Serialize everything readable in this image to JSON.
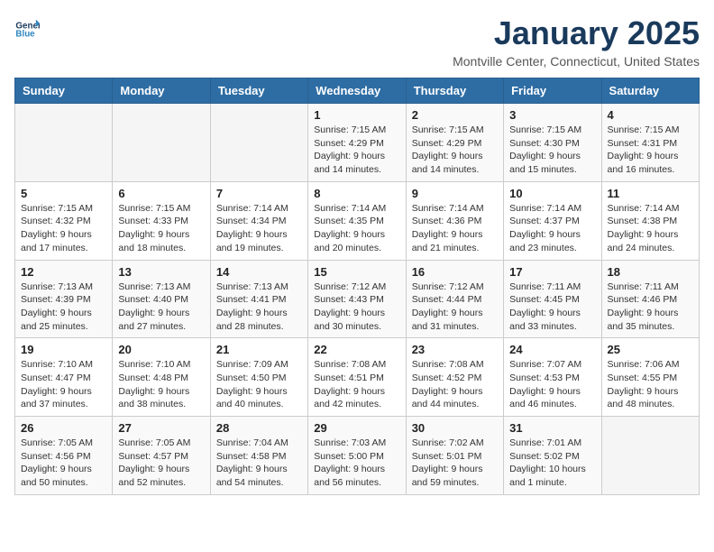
{
  "header": {
    "logo_line1": "General",
    "logo_line2": "Blue",
    "month": "January 2025",
    "location": "Montville Center, Connecticut, United States"
  },
  "days_of_week": [
    "Sunday",
    "Monday",
    "Tuesday",
    "Wednesday",
    "Thursday",
    "Friday",
    "Saturday"
  ],
  "weeks": [
    [
      {
        "day": "",
        "info": ""
      },
      {
        "day": "",
        "info": ""
      },
      {
        "day": "",
        "info": ""
      },
      {
        "day": "1",
        "info": "Sunrise: 7:15 AM\nSunset: 4:29 PM\nDaylight: 9 hours\nand 14 minutes."
      },
      {
        "day": "2",
        "info": "Sunrise: 7:15 AM\nSunset: 4:29 PM\nDaylight: 9 hours\nand 14 minutes."
      },
      {
        "day": "3",
        "info": "Sunrise: 7:15 AM\nSunset: 4:30 PM\nDaylight: 9 hours\nand 15 minutes."
      },
      {
        "day": "4",
        "info": "Sunrise: 7:15 AM\nSunset: 4:31 PM\nDaylight: 9 hours\nand 16 minutes."
      }
    ],
    [
      {
        "day": "5",
        "info": "Sunrise: 7:15 AM\nSunset: 4:32 PM\nDaylight: 9 hours\nand 17 minutes."
      },
      {
        "day": "6",
        "info": "Sunrise: 7:15 AM\nSunset: 4:33 PM\nDaylight: 9 hours\nand 18 minutes."
      },
      {
        "day": "7",
        "info": "Sunrise: 7:14 AM\nSunset: 4:34 PM\nDaylight: 9 hours\nand 19 minutes."
      },
      {
        "day": "8",
        "info": "Sunrise: 7:14 AM\nSunset: 4:35 PM\nDaylight: 9 hours\nand 20 minutes."
      },
      {
        "day": "9",
        "info": "Sunrise: 7:14 AM\nSunset: 4:36 PM\nDaylight: 9 hours\nand 21 minutes."
      },
      {
        "day": "10",
        "info": "Sunrise: 7:14 AM\nSunset: 4:37 PM\nDaylight: 9 hours\nand 23 minutes."
      },
      {
        "day": "11",
        "info": "Sunrise: 7:14 AM\nSunset: 4:38 PM\nDaylight: 9 hours\nand 24 minutes."
      }
    ],
    [
      {
        "day": "12",
        "info": "Sunrise: 7:13 AM\nSunset: 4:39 PM\nDaylight: 9 hours\nand 25 minutes."
      },
      {
        "day": "13",
        "info": "Sunrise: 7:13 AM\nSunset: 4:40 PM\nDaylight: 9 hours\nand 27 minutes."
      },
      {
        "day": "14",
        "info": "Sunrise: 7:13 AM\nSunset: 4:41 PM\nDaylight: 9 hours\nand 28 minutes."
      },
      {
        "day": "15",
        "info": "Sunrise: 7:12 AM\nSunset: 4:43 PM\nDaylight: 9 hours\nand 30 minutes."
      },
      {
        "day": "16",
        "info": "Sunrise: 7:12 AM\nSunset: 4:44 PM\nDaylight: 9 hours\nand 31 minutes."
      },
      {
        "day": "17",
        "info": "Sunrise: 7:11 AM\nSunset: 4:45 PM\nDaylight: 9 hours\nand 33 minutes."
      },
      {
        "day": "18",
        "info": "Sunrise: 7:11 AM\nSunset: 4:46 PM\nDaylight: 9 hours\nand 35 minutes."
      }
    ],
    [
      {
        "day": "19",
        "info": "Sunrise: 7:10 AM\nSunset: 4:47 PM\nDaylight: 9 hours\nand 37 minutes."
      },
      {
        "day": "20",
        "info": "Sunrise: 7:10 AM\nSunset: 4:48 PM\nDaylight: 9 hours\nand 38 minutes."
      },
      {
        "day": "21",
        "info": "Sunrise: 7:09 AM\nSunset: 4:50 PM\nDaylight: 9 hours\nand 40 minutes."
      },
      {
        "day": "22",
        "info": "Sunrise: 7:08 AM\nSunset: 4:51 PM\nDaylight: 9 hours\nand 42 minutes."
      },
      {
        "day": "23",
        "info": "Sunrise: 7:08 AM\nSunset: 4:52 PM\nDaylight: 9 hours\nand 44 minutes."
      },
      {
        "day": "24",
        "info": "Sunrise: 7:07 AM\nSunset: 4:53 PM\nDaylight: 9 hours\nand 46 minutes."
      },
      {
        "day": "25",
        "info": "Sunrise: 7:06 AM\nSunset: 4:55 PM\nDaylight: 9 hours\nand 48 minutes."
      }
    ],
    [
      {
        "day": "26",
        "info": "Sunrise: 7:05 AM\nSunset: 4:56 PM\nDaylight: 9 hours\nand 50 minutes."
      },
      {
        "day": "27",
        "info": "Sunrise: 7:05 AM\nSunset: 4:57 PM\nDaylight: 9 hours\nand 52 minutes."
      },
      {
        "day": "28",
        "info": "Sunrise: 7:04 AM\nSunset: 4:58 PM\nDaylight: 9 hours\nand 54 minutes."
      },
      {
        "day": "29",
        "info": "Sunrise: 7:03 AM\nSunset: 5:00 PM\nDaylight: 9 hours\nand 56 minutes."
      },
      {
        "day": "30",
        "info": "Sunrise: 7:02 AM\nSunset: 5:01 PM\nDaylight: 9 hours\nand 59 minutes."
      },
      {
        "day": "31",
        "info": "Sunrise: 7:01 AM\nSunset: 5:02 PM\nDaylight: 10 hours\nand 1 minute."
      },
      {
        "day": "",
        "info": ""
      }
    ]
  ]
}
